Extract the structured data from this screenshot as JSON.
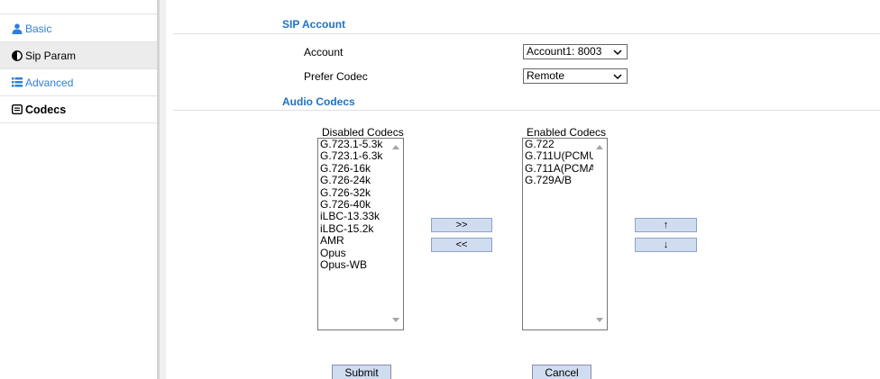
{
  "sidebar": {
    "items": [
      {
        "label": "Basic",
        "icon": "user-icon"
      },
      {
        "label": "Sip Param",
        "icon": "contrast-icon"
      },
      {
        "label": "Advanced",
        "icon": "list-icon"
      },
      {
        "label": "Codecs",
        "icon": "codec-icon"
      }
    ]
  },
  "sip_account": {
    "title": "SIP Account",
    "account_label": "Account",
    "account_value": "Account1: 8003",
    "prefer_codec_label": "Prefer Codec",
    "prefer_codec_value": "Remote"
  },
  "audio_codecs": {
    "title": "Audio Codecs",
    "disabled_caption": "Disabled Codecs",
    "disabled": [
      "G.723.1-5.3k",
      "G.723.1-6.3k",
      "G.726-16k",
      "G.726-24k",
      "G.726-32k",
      "G.726-40k",
      "iLBC-13.33k",
      "iLBC-15.2k",
      "AMR",
      "Opus",
      "Opus-WB"
    ],
    "enabled_caption": "Enabled Codecs",
    "enabled": [
      "G.722",
      "G.711U(PCMU",
      "G.711A(PCMA",
      "G.729A/B"
    ],
    "move_right_label": ">>",
    "move_left_label": "<<",
    "move_up_label": "↑",
    "move_down_label": "↓"
  },
  "actions": {
    "submit_label": "Submit",
    "cancel_label": "Cancel"
  },
  "colors": {
    "accent": "#1e73c6",
    "link": "#2f7fd8",
    "button_bg": "#d0dcf0"
  }
}
